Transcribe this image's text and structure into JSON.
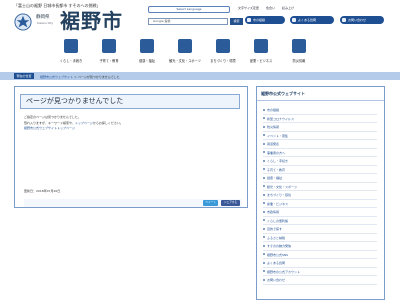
{
  "header": {
    "tagline": "「富士山の裾野 日城市長都市 すそのへの挑戦」",
    "prefecture": "静岡県",
    "logo_en": "Susono City",
    "city_name": "裾野市",
    "select_language": "Select Language",
    "utilities": [
      "文字サイズ変更",
      "色合い",
      "読み上げ"
    ],
    "search_placeholder": "Google 提供",
    "search_button": "検索",
    "quick_links": [
      "市の組織",
      "よくある質問",
      "お問い合わせ"
    ]
  },
  "nav": {
    "items": [
      {
        "label": "くらし・手続き",
        "icon": "person-icon"
      },
      {
        "label": "子育て・教育",
        "icon": "family-icon"
      },
      {
        "label": "健康・福祉",
        "icon": "medical-cross-icon"
      },
      {
        "label": "観光・文化・スポーツ",
        "icon": "mountain-icon"
      },
      {
        "label": "まちづくり・環境",
        "icon": "building-icon"
      },
      {
        "label": "産業・ビジネス",
        "icon": "business-icon"
      },
      {
        "label": "防災情報",
        "icon": "disaster-icon"
      }
    ]
  },
  "breadcrumb": {
    "tag": "現在の位置",
    "home": "裾野市公式ウェブサイト",
    "current": "ページが見つかりませんでした"
  },
  "main": {
    "title": "ページが見つかりませんでした",
    "line1": "ご指定のページは見つかりませんでした。",
    "line2_prefix": "恐れ入りますが、キーワード検索や、",
    "line2_link": "トップページ",
    "line2_suffix": "からお探しください。",
    "top_link": "裾野市公式ウェブサイトトップページ",
    "updated_label": "更新日：",
    "updated_date": "2018年07月20日",
    "share_x": "ツイート",
    "share_fb": "シェアする"
  },
  "sidebar": {
    "title": "裾野市公式ウェブサイト",
    "items": [
      "市の組織",
      "新型コロナウイルス",
      "防災情報",
      "イベント・募集",
      "報道発表",
      "事業者の方へ",
      "くらし・手続き",
      "子育て・教育",
      "健康・福祉",
      "観光・文化・スポーツ",
      "まちづくり・環境",
      "産業・ビジネス",
      "市政情報",
      "くらしの便利帳",
      "目的で探す",
      "ふるさと納税",
      "すそのの魅力発信",
      "裾野市公式SNS",
      "よくある質問",
      "裾野市の公式アカウント",
      "お問い合わせ"
    ]
  },
  "colors": {
    "brand": "#1f4f93",
    "logo_text": "#24415f",
    "breadcrumb_bg": "#b4ccea",
    "border": "#7c9ccb"
  }
}
